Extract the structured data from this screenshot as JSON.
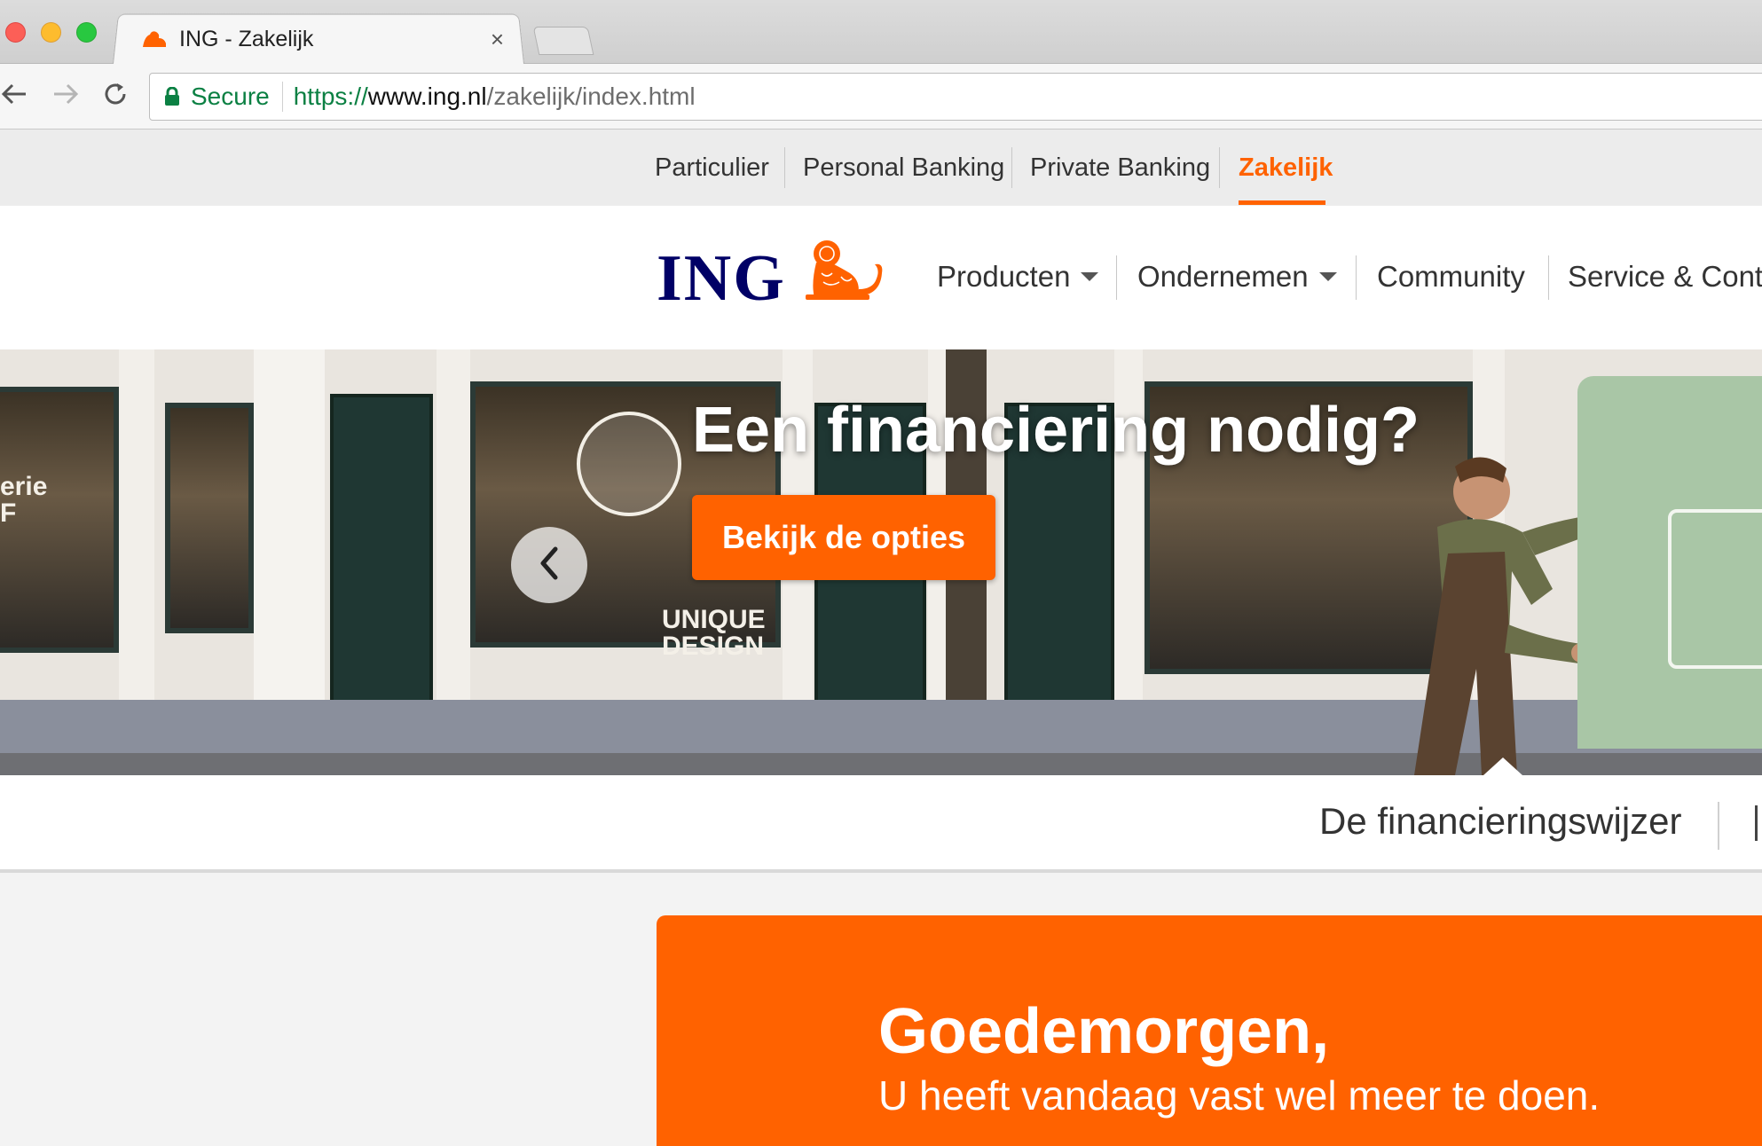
{
  "browser": {
    "tab_title": "ING - Zakelijk",
    "tab_close": "×",
    "secure_label": "Secure",
    "url_scheme": "https://",
    "url_host": "www.ing.nl",
    "url_path": "/zakelijk/index.html"
  },
  "segments": [
    {
      "label": "Particulier"
    },
    {
      "label": "Personal Banking"
    },
    {
      "label": "Private Banking"
    },
    {
      "label": "Zakelijk",
      "active": true
    }
  ],
  "header": {
    "logo_text": "ING",
    "menu": [
      {
        "label": "Producten",
        "has_dropdown": true
      },
      {
        "label": "Ondernemen",
        "has_dropdown": true
      },
      {
        "label": "Community",
        "has_dropdown": false
      },
      {
        "label": "Service & Conta",
        "has_dropdown": false
      }
    ]
  },
  "hero": {
    "title": "Een financiering nodig?",
    "cta_label": "Bekijk de opties",
    "sign_left": "erie\nF",
    "sign_shop": "UNIQUE\nDESIGN"
  },
  "subnav": {
    "active_item": "De financieringswijzer"
  },
  "greeting": {
    "title": "Goedemorgen,",
    "subtitle": "U heeft vandaag vast wel meer te doen."
  },
  "colors": {
    "brand_orange": "#ff6200",
    "brand_navy": "#000066",
    "secure_green": "#0b8043"
  }
}
